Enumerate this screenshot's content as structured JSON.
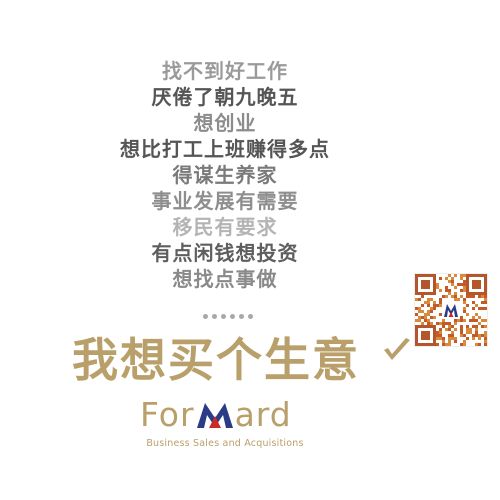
{
  "lines": [
    {
      "text": "找不到好工作",
      "color": "#9a9a9a"
    },
    {
      "text": "厌倦了朝九晚五",
      "color": "#555555"
    },
    {
      "text": "想创业",
      "color": "#8c8c8c"
    },
    {
      "text": "想比打工上班赚得多点",
      "color": "#555555"
    },
    {
      "text": "得谋生养家",
      "color": "#7a7a7a"
    },
    {
      "text": "事业发展有需要",
      "color": "#8e8e8e"
    },
    {
      "text": "移民有要求",
      "color": "#b4b4b4"
    },
    {
      "text": "有点闲钱想投资",
      "color": "#5e5e5e"
    },
    {
      "text": "想找点事做",
      "color": "#8a8a8a"
    }
  ],
  "headline": {
    "text": "我想买个生意",
    "color": "#b9a06a"
  },
  "logo": {
    "left_text": "For",
    "right_text": "ard",
    "gold": "#b9a06a",
    "blue": "#2c3b86",
    "red": "#cc2a2a"
  },
  "tagline": {
    "text": "Business Sales and Acquisitions",
    "color": "#b9a06a"
  },
  "icons": {
    "qr": "qr-code-icon",
    "check": "checkmark-icon",
    "dots": "ellipsis-dots"
  }
}
